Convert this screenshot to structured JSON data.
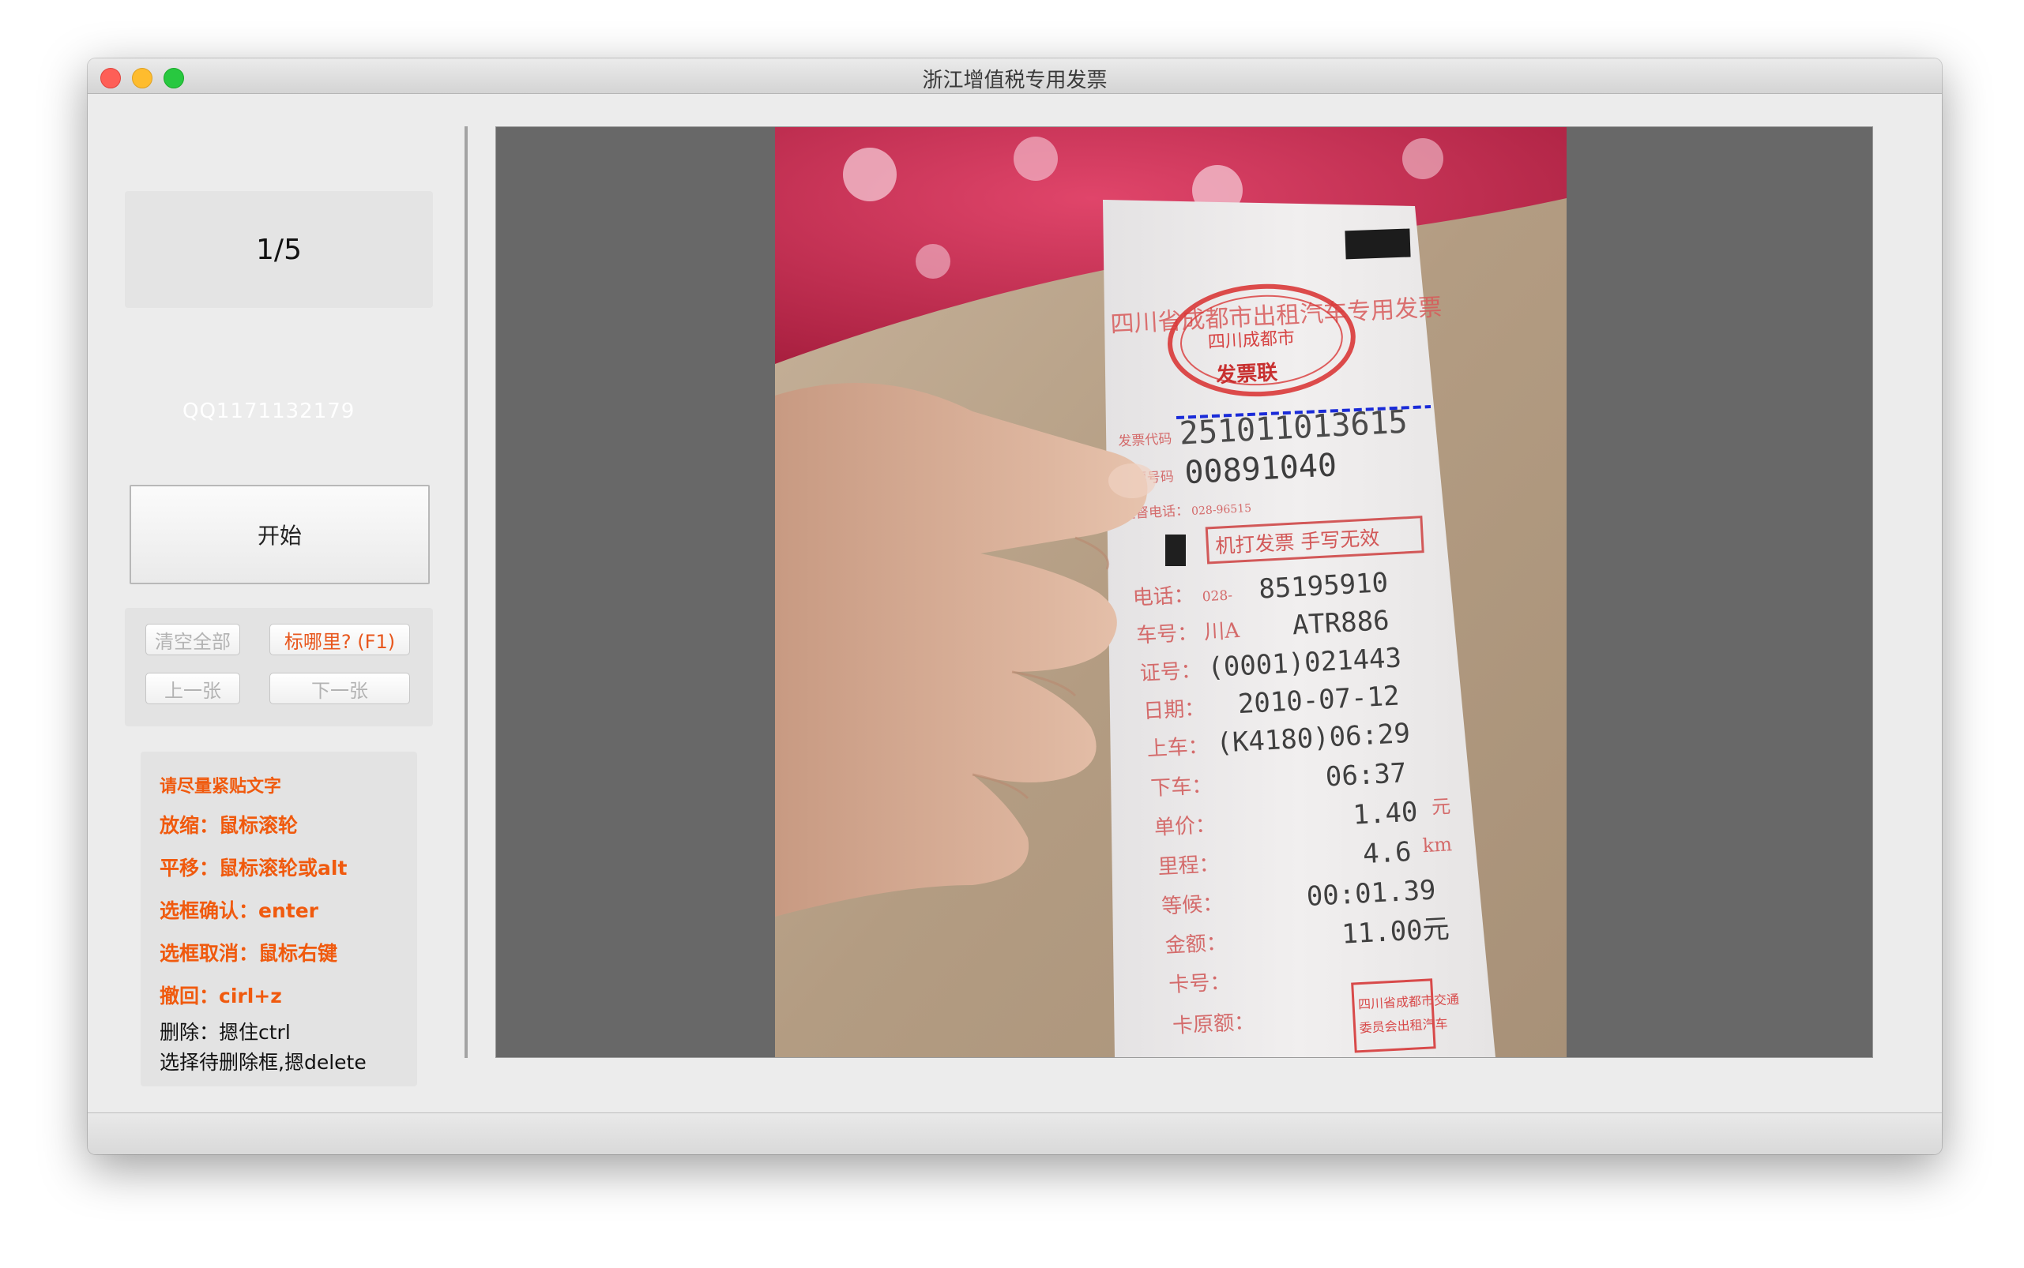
{
  "window": {
    "title": "浙江增值税专用发票"
  },
  "left_panel": {
    "counter": "1/5",
    "qq": "QQ1171132179",
    "start_button": "开始",
    "buttons": {
      "clear_all": "清空全部",
      "where_to_label": "标哪里? (F1)",
      "prev": "上一张",
      "next": "下一张"
    },
    "help": [
      "请尽量紧贴文字",
      "放缩：鼠标滚轮",
      "平移：鼠标滚轮或alt",
      "选框确认：enter",
      "选框取消：鼠标右键",
      "撤回：cirl+z",
      "删除：摁住ctrl",
      "选择待删除框,摁delete"
    ]
  },
  "receipt": {
    "header": "四川省成都市出租汽车专用发票",
    "stamp_line1": "四川成都市",
    "stamp_line2": "发票联",
    "code_label": "发票代码",
    "code": "251011013615",
    "number_label": "发票号码",
    "number": "00891040",
    "phone_label": "监督电话：",
    "phone": "028-96515",
    "machine_printed": "机打发票 手写无效",
    "rows": [
      {
        "label": "电话：",
        "value": "85195910",
        "prefix": "028-",
        "unit": ""
      },
      {
        "label": "车号：",
        "value": "ATR886",
        "prefix": "川A",
        "unit": ""
      },
      {
        "label": "证号：",
        "value": "(0001)021443",
        "prefix": "",
        "unit": ""
      },
      {
        "label": "日期：",
        "value": "2010-07-12",
        "prefix": "",
        "unit": ""
      },
      {
        "label": "上车：",
        "value": "(K4180)06:29",
        "prefix": "",
        "unit": ""
      },
      {
        "label": "下车：",
        "value": "06:37",
        "prefix": "",
        "unit": ""
      },
      {
        "label": "单价：",
        "value": "1.40",
        "prefix": "",
        "unit": "元"
      },
      {
        "label": "里程：",
        "value": "4.6",
        "prefix": "",
        "unit": "km"
      },
      {
        "label": "等候：",
        "value": "00:01.39",
        "prefix": "",
        "unit": ""
      },
      {
        "label": "金额：",
        "value": "11.00元",
        "prefix": "",
        "unit": ""
      },
      {
        "label": "卡号：",
        "value": "",
        "prefix": "",
        "unit": ""
      },
      {
        "label": "卡原额：",
        "value": "",
        "prefix": "",
        "unit": ""
      }
    ],
    "seal_line1": "四川省成都市交通",
    "seal_line2": "委员会出租汽车"
  },
  "colors": {
    "accent": "#f05a0e",
    "canvas_bg": "#686868",
    "annotation": "#1a2bd8"
  }
}
